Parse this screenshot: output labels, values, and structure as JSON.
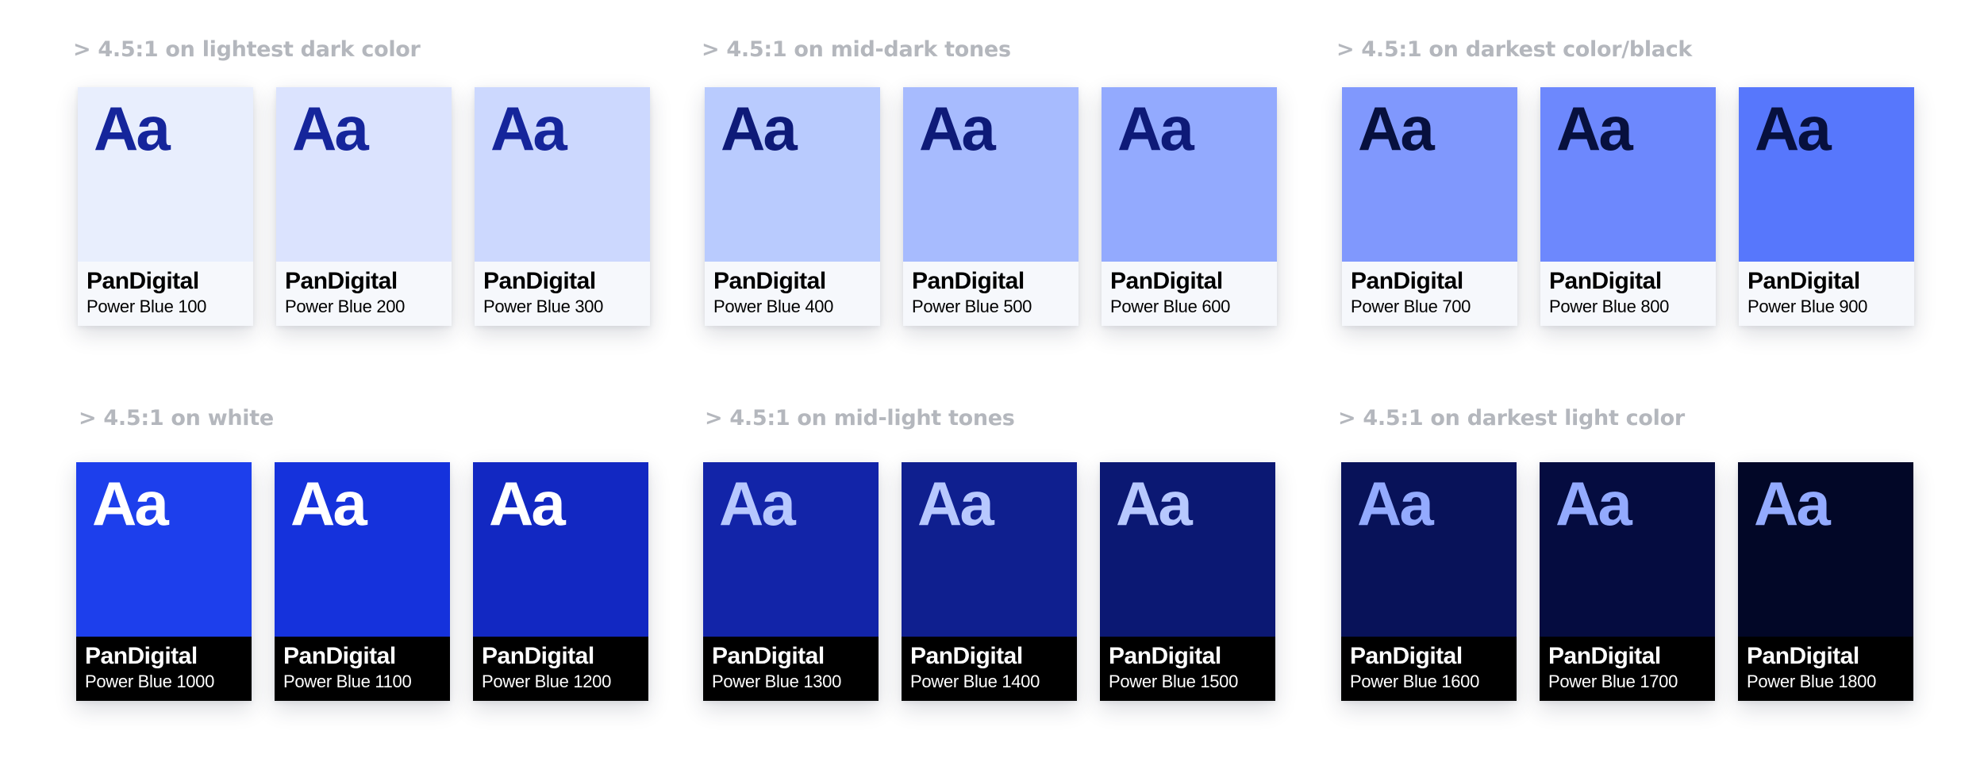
{
  "groups": [
    {
      "heading": "> 4.5:1 on lightest dark color"
    },
    {
      "heading": "> 4.5:1 on mid-dark tones"
    },
    {
      "heading": "> 4.5:1 on darkest color/black"
    },
    {
      "heading": "> 4.5:1 on white"
    },
    {
      "heading": "> 4.5:1 on mid-light tones"
    },
    {
      "heading": "> 4.5:1 on darkest light color"
    }
  ],
  "swatches": [
    {
      "sample": "Aa",
      "brand": "PanDigital",
      "name": "Power Blue 100",
      "color": "#e8eefd",
      "sample_color": "#15259b",
      "label_bg": "#f6f8fc",
      "label_color": "#000000"
    },
    {
      "sample": "Aa",
      "brand": "PanDigital",
      "name": "Power Blue 200",
      "color": "#dbe3fe",
      "sample_color": "#15259b",
      "label_bg": "#f6f8fc",
      "label_color": "#000000"
    },
    {
      "sample": "Aa",
      "brand": "PanDigital",
      "name": "Power Blue 300",
      "color": "#ccd8fe",
      "sample_color": "#15259b",
      "label_bg": "#f6f8fc",
      "label_color": "#000000"
    },
    {
      "sample": "Aa",
      "brand": "PanDigital",
      "name": "Power Blue 400",
      "color": "#b9cbfe",
      "sample_color": "#0e1a78",
      "label_bg": "#f6f8fc",
      "label_color": "#000000"
    },
    {
      "sample": "Aa",
      "brand": "PanDigital",
      "name": "Power Blue 500",
      "color": "#a7bbfe",
      "sample_color": "#0e1a78",
      "label_bg": "#f6f8fc",
      "label_color": "#000000"
    },
    {
      "sample": "Aa",
      "brand": "PanDigital",
      "name": "Power Blue 600",
      "color": "#93aafe",
      "sample_color": "#0e1a78",
      "label_bg": "#f6f8fc",
      "label_color": "#000000"
    },
    {
      "sample": "Aa",
      "brand": "PanDigital",
      "name": "Power Blue 700",
      "color": "#8098fd",
      "sample_color": "#07103e",
      "label_bg": "#f6f8fc",
      "label_color": "#000000"
    },
    {
      "sample": "Aa",
      "brand": "PanDigital",
      "name": "Power Blue 800",
      "color": "#6d88fd",
      "sample_color": "#07103e",
      "label_bg": "#f6f8fc",
      "label_color": "#000000"
    },
    {
      "sample": "Aa",
      "brand": "PanDigital",
      "name": "Power Blue 900",
      "color": "#5777fc",
      "sample_color": "#07103e",
      "label_bg": "#f6f8fc",
      "label_color": "#000000"
    },
    {
      "sample": "Aa",
      "brand": "PanDigital",
      "name": "Power Blue 1000",
      "color": "#1d3fec",
      "sample_color": "#ffffff",
      "label_bg": "#000000",
      "label_color": "#ffffff"
    },
    {
      "sample": "Aa",
      "brand": "PanDigital",
      "name": "Power Blue 1100",
      "color": "#1532dc",
      "sample_color": "#ffffff",
      "label_bg": "#000000",
      "label_color": "#ffffff"
    },
    {
      "sample": "Aa",
      "brand": "PanDigital",
      "name": "Power Blue 1200",
      "color": "#1228c2",
      "sample_color": "#ffffff",
      "label_bg": "#000000",
      "label_color": "#ffffff"
    },
    {
      "sample": "Aa",
      "brand": "PanDigital",
      "name": "Power Blue 1300",
      "color": "#1224a8",
      "sample_color": "#b7c8fe",
      "label_bg": "#000000",
      "label_color": "#ffffff"
    },
    {
      "sample": "Aa",
      "brand": "PanDigital",
      "name": "Power Blue 1400",
      "color": "#0f1f8f",
      "sample_color": "#b7c8fe",
      "label_bg": "#000000",
      "label_color": "#ffffff"
    },
    {
      "sample": "Aa",
      "brand": "PanDigital",
      "name": "Power Blue 1500",
      "color": "#0b1873",
      "sample_color": "#b7c8fe",
      "label_bg": "#000000",
      "label_color": "#ffffff"
    },
    {
      "sample": "Aa",
      "brand": "PanDigital",
      "name": "Power Blue 1600",
      "color": "#081259",
      "sample_color": "#93aafe",
      "label_bg": "#000000",
      "label_color": "#ffffff"
    },
    {
      "sample": "Aa",
      "brand": "PanDigital",
      "name": "Power Blue 1700",
      "color": "#050c40",
      "sample_color": "#93aafe",
      "label_bg": "#000000",
      "label_color": "#ffffff"
    },
    {
      "sample": "Aa",
      "brand": "PanDigital",
      "name": "Power Blue 1800",
      "color": "#020727",
      "sample_color": "#93aafe",
      "label_bg": "#000000",
      "label_color": "#ffffff"
    }
  ]
}
